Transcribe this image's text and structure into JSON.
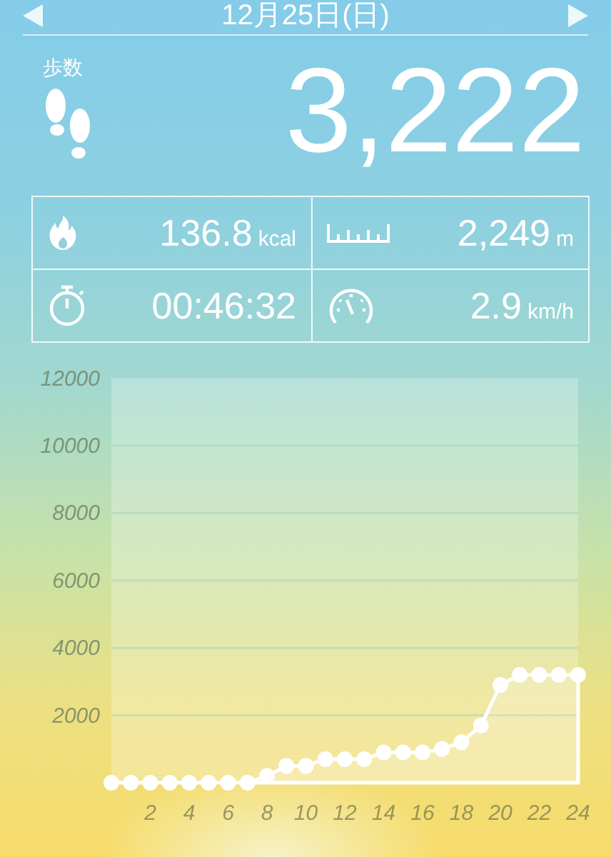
{
  "header": {
    "date": "12月25日(日)"
  },
  "steps": {
    "label": "歩数",
    "value": "3,222"
  },
  "stats": [
    {
      "kind": "calories",
      "value": "136.8",
      "unit": "kcal"
    },
    {
      "kind": "distance",
      "value": "2,249",
      "unit": "m"
    },
    {
      "kind": "duration",
      "value": "00:46:32"
    },
    {
      "kind": "speed",
      "value": "2.9",
      "unit": "km/h"
    }
  ],
  "chart": {
    "chart_data": {
      "type": "area",
      "x": [
        0,
        1,
        2,
        3,
        4,
        5,
        6,
        7,
        8,
        9,
        10,
        11,
        12,
        13,
        14,
        15,
        16,
        17,
        18,
        19,
        20,
        21,
        22,
        23,
        24
      ],
      "series": [
        {
          "color": "#ffffff",
          "values": [
            0,
            0,
            0,
            0,
            0,
            0,
            0,
            0,
            200,
            500,
            500,
            700,
            700,
            700,
            900,
            900,
            900,
            1000,
            1200,
            1700,
            2900,
            3200,
            3200,
            3200,
            3200
          ]
        }
      ],
      "grid": true,
      "xlim": [
        0,
        24
      ],
      "ylim": [
        0,
        12000
      ],
      "xticks": [
        2,
        4,
        6,
        8,
        10,
        12,
        14,
        16,
        18,
        20,
        22,
        24
      ],
      "yticks": [
        2000,
        4000,
        6000,
        8000,
        10000,
        12000
      ]
    }
  }
}
